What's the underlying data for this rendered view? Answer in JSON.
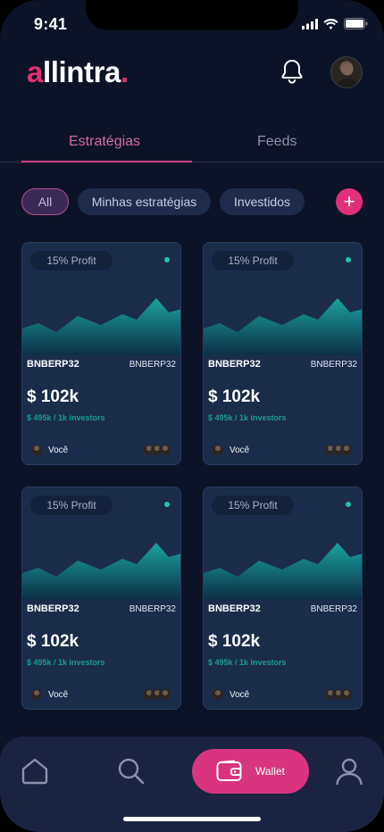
{
  "status_bar": {
    "time": "9:41"
  },
  "header": {
    "logo_part1": "a",
    "logo_part2": "llintra",
    "logo_dot": ".",
    "brand_color": "#e0306f"
  },
  "tabs": [
    {
      "label": "Estratégias",
      "active": true
    },
    {
      "label": "Feeds",
      "active": false
    }
  ],
  "filters": [
    {
      "label": "All",
      "selected": true
    },
    {
      "label": "Minhas estratégias",
      "selected": false
    },
    {
      "label": "Investidos",
      "selected": false
    }
  ],
  "add_button": {
    "icon": "plus-icon",
    "glyph": "+"
  },
  "cards": [
    {
      "profit": "15% Profit",
      "name": "BNBERP32",
      "code": "BNBERP32",
      "amount": "$ 102k",
      "subtitle": "$ 495k / 1k investors",
      "owner": "Você"
    },
    {
      "profit": "15% Profit",
      "name": "BNBERP32",
      "code": "BNBERP32",
      "amount": "$ 102k",
      "subtitle": "$ 495k / 1k investors",
      "owner": "Você"
    },
    {
      "profit": "15% Profit",
      "name": "BNBERP32",
      "code": "BNBERP32",
      "amount": "$ 102k",
      "subtitle": "$ 495k / 1k investors",
      "owner": "Você"
    },
    {
      "profit": "15% Profit",
      "name": "BNBERP32",
      "code": "BNBERP32",
      "amount": "$ 102k",
      "subtitle": "$ 495k / 1k investors",
      "owner": "Você"
    }
  ],
  "bottom_nav": {
    "items": [
      {
        "icon": "home-icon"
      },
      {
        "icon": "search-icon"
      },
      {
        "icon": "wallet-icon",
        "label": "Wallet",
        "active": true
      },
      {
        "icon": "profile-icon"
      }
    ],
    "active_color": "#d9357f"
  }
}
